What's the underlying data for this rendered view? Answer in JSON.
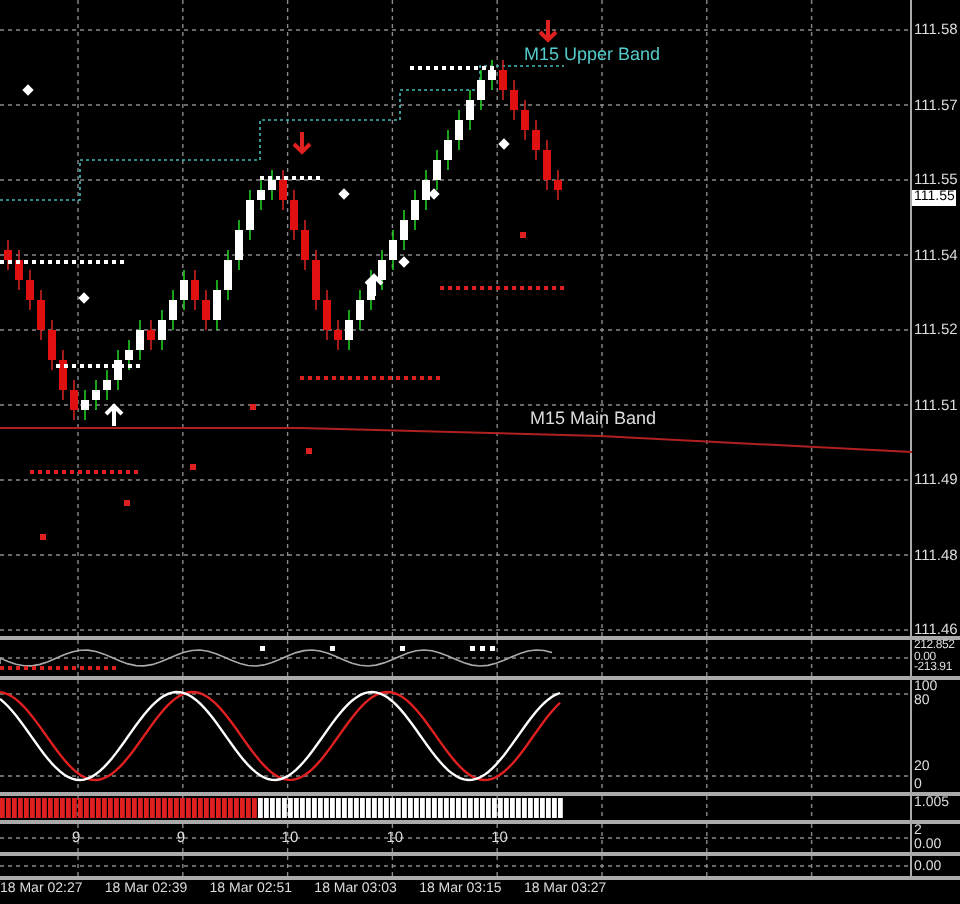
{
  "main_chart": {
    "price_axis": [
      "111.58",
      "111.57",
      "111.55",
      "111.54",
      "111.52",
      "111.51",
      "111.49",
      "111.48",
      "111.46"
    ],
    "current_price": "111.55",
    "annotations": [
      {
        "kind": "upper",
        "text": "M15 Upper Band"
      },
      {
        "kind": "main",
        "text": "M15 Main Band"
      }
    ]
  },
  "indicator_panels": [
    {
      "kind": "oscillator",
      "labels": [
        "212.852",
        "0.00",
        "-213.91"
      ]
    },
    {
      "kind": "stochastic",
      "labels": [
        "100",
        "80",
        "20",
        "0"
      ]
    },
    {
      "kind": "bars",
      "labels": [
        "1.005"
      ]
    },
    {
      "kind": "counts",
      "labels": [
        "2",
        "0.00"
      ],
      "counts": [
        "9",
        "9",
        "10",
        "10",
        "10"
      ]
    },
    {
      "kind": "empty",
      "labels": [
        "0.00"
      ]
    }
  ],
  "time_axis": [
    "18 Mar 02:27",
    "18 Mar 02:39",
    "18 Mar 02:51",
    "18 Mar 03:03",
    "18 Mar 03:15",
    "18 Mar 03:27"
  ]
}
